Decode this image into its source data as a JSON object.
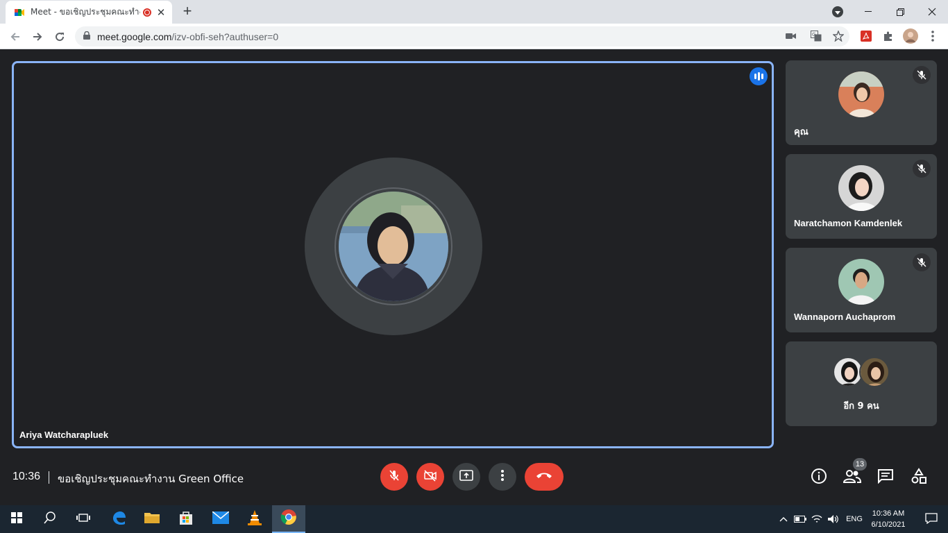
{
  "browser": {
    "tab_title": "Meet - ขอเชิญประชุมคณะทำงาน",
    "url_domain": "meet.google.com",
    "url_path": "/izv-obfi-seh?authuser=0"
  },
  "main_tile": {
    "participant_name": "Ariya Watcharapluek"
  },
  "side_tiles": [
    {
      "name": "คุณ"
    },
    {
      "name": "Naratchamon Kamdenlek"
    },
    {
      "name": "Wannaporn Auchaprom"
    }
  ],
  "more_tile": {
    "label": "อีก 9 คน"
  },
  "bottom_bar": {
    "time": "10:36",
    "meeting_title": "ขอเชิญประชุมคณะทำงาน Green Office",
    "people_count": "13"
  },
  "taskbar": {
    "language": "ENG",
    "time": "10:36 AM",
    "date": "6/10/2021"
  },
  "colors": {
    "accent_blue": "#8ab4f8",
    "leave_red": "#ea4335",
    "background": "#202124",
    "tile": "#3c4043"
  }
}
